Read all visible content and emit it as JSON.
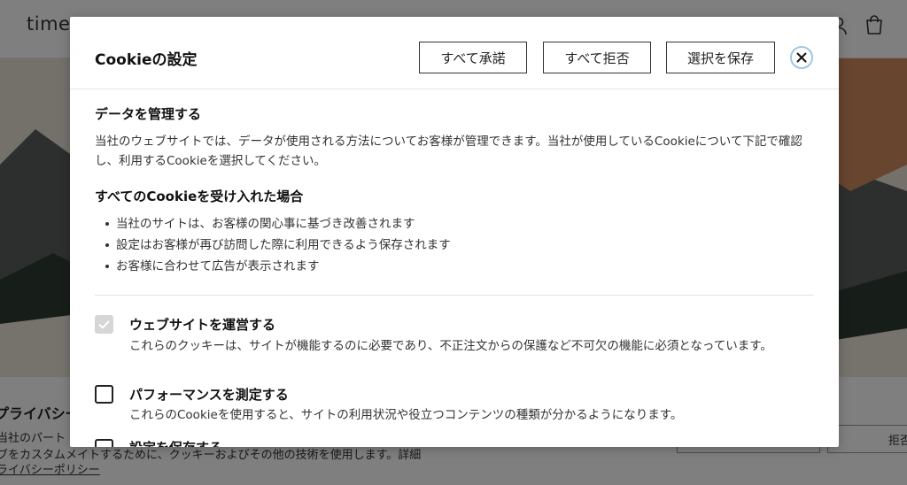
{
  "background": {
    "logo": "timep",
    "banner": {
      "title": "プライバシー",
      "line1": "当社のパート",
      "line2": "ブをカスタムメイトするために、クッキーおよびその他の技術を使用します。詳細",
      "link": "ライバシーポリシー",
      "reject_label": "拒否"
    }
  },
  "modal": {
    "title": "Cookieの設定",
    "buttons": {
      "accept_all": "すべて承諾",
      "reject_all": "すべて拒否",
      "save": "選択を保存"
    },
    "close_icon": "close-icon",
    "manage": {
      "heading": "データを管理する",
      "text": "当社のウェブサイトでは、データが使用される方法についてお客様が管理できます。当社が使用しているCookieについて下記で確認し、利用するCookieを選択してください。"
    },
    "accepted": {
      "heading": "すべてのCookieを受け入れた場合",
      "bullets": [
        "当社のサイトは、お客様の関心事に基づき改善されます",
        "設定はお客様が再び訪問した際に利用できるよう保存されます",
        "お客様に合わせて広告が表示されます"
      ]
    },
    "options": [
      {
        "title": "ウェブサイトを運営する",
        "description": "これらのクッキーは、サイトが機能するのに必要であり、不正注文からの保護など不可欠の機能に必須となっています。",
        "checked": true,
        "disabled": true
      },
      {
        "title": "パフォーマンスを測定する",
        "description": "これらのCookieを使用すると、サイトの利用状況や役立つコンテンツの種類が分かるようになります。",
        "checked": false,
        "disabled": false
      },
      {
        "title": "設定を保存する",
        "checked": false,
        "disabled": false
      }
    ]
  },
  "colors": {
    "overlay": "#000000",
    "close_ring": "#9ec6e6"
  }
}
